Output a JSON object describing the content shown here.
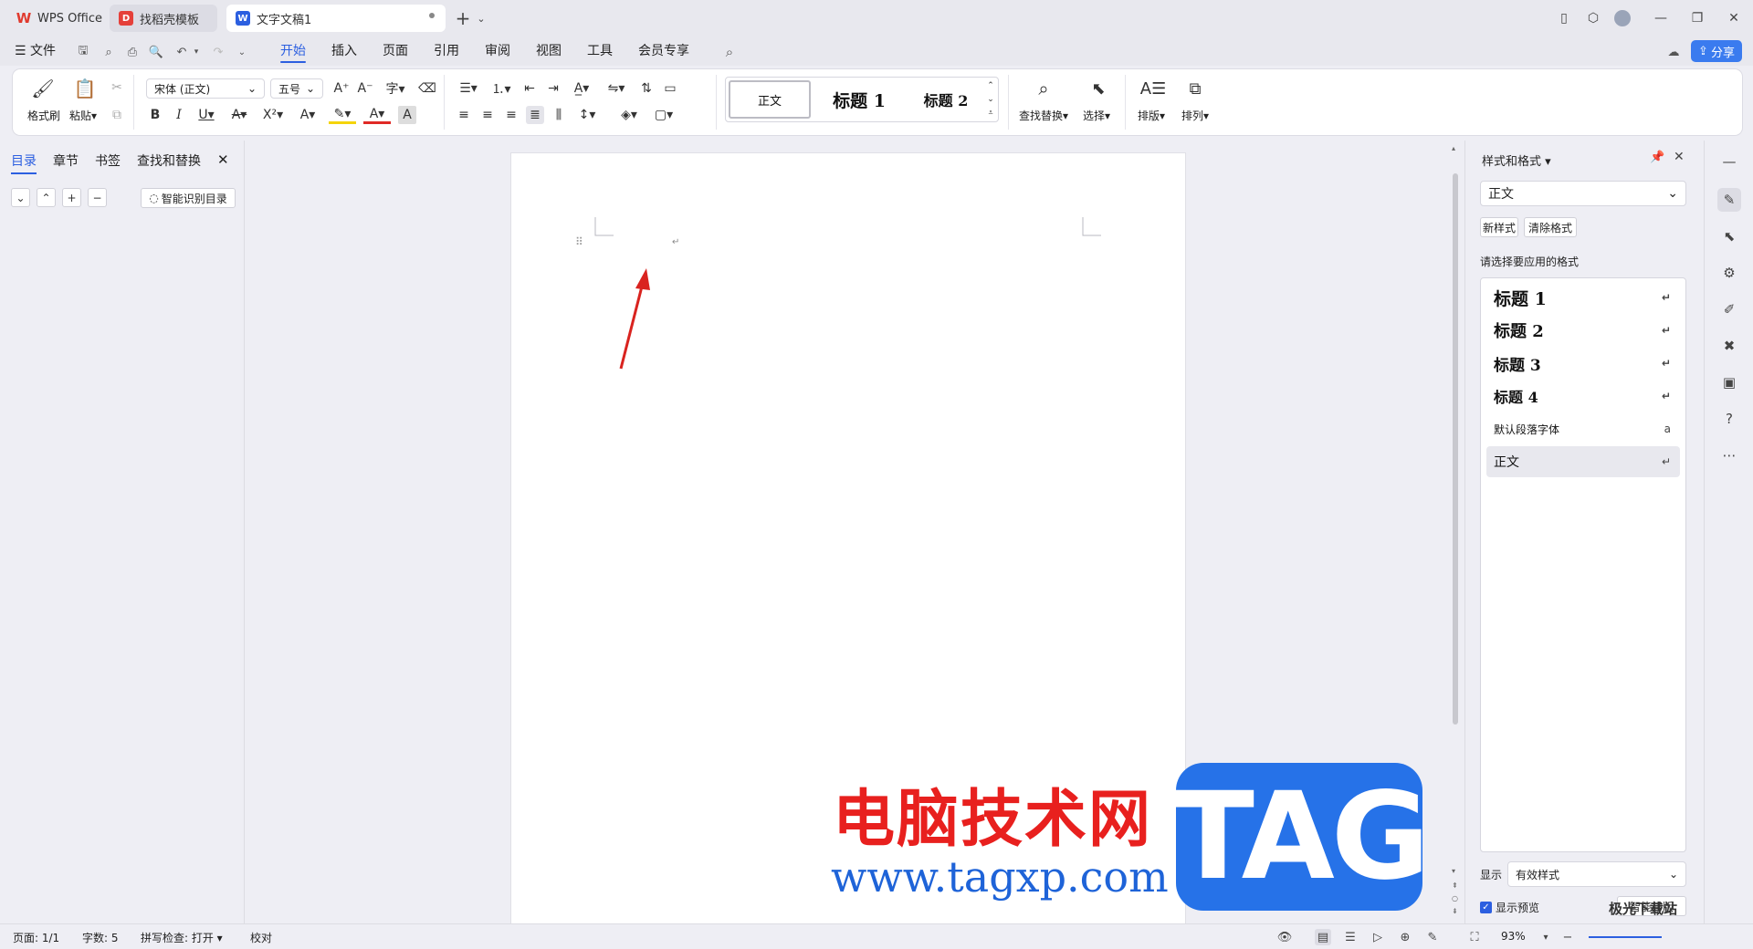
{
  "titlebar": {
    "tabs": [
      {
        "label": "WPS Office"
      },
      {
        "label": "找稻壳模板"
      },
      {
        "label": "文字文稿1"
      }
    ],
    "new_tab": "+",
    "new_tab_menu": "⌄"
  },
  "menubar": {
    "file": "文件",
    "tabs": [
      "开始",
      "插入",
      "页面",
      "引用",
      "审阅",
      "视图",
      "工具",
      "会员专享"
    ],
    "active_tab": "开始",
    "share": "分享"
  },
  "ribbon": {
    "format_painter": "格式刷",
    "paste": "粘贴",
    "font_name": "宋体 (正文)",
    "font_size": "五号",
    "styles": {
      "normal": "正文",
      "heading1": "标题 1",
      "heading2": "标题 2"
    },
    "find_replace": "查找替换",
    "select": "选择",
    "layout": "排版",
    "arrange": "排列"
  },
  "left_panel": {
    "tabs": [
      "目录",
      "章节",
      "书签",
      "查找和替换"
    ],
    "active_tab": "目录",
    "smart_toc": "智能识别目录"
  },
  "right_panel": {
    "title": "样式和格式",
    "current_style": "正文",
    "new_style": "新样式",
    "clear_format": "清除格式",
    "hint": "请选择要应用的格式",
    "style_items": [
      {
        "label": "标题 1",
        "marker": "↵"
      },
      {
        "label": "标题 2",
        "marker": "↵"
      },
      {
        "label": "标题 3",
        "marker": "↵"
      },
      {
        "label": "标题 4",
        "marker": "↵"
      },
      {
        "label": "默认段落字体",
        "marker": "a"
      },
      {
        "label": "正文",
        "marker": "↵"
      }
    ],
    "selected_style": "正文",
    "show_label": "显示",
    "show_value": "有效样式",
    "show_preview": "显示预览",
    "smart_layout": "智能排版"
  },
  "statusbar": {
    "page": "页面: 1/1",
    "words": "字数: 5",
    "spellcheck": "拼写检查: 打开",
    "proofread": "校对",
    "zoom": "93%"
  },
  "watermark": {
    "cn_text": "电脑技术网",
    "url": "www.tagxp.com",
    "tag": "TAG",
    "site": "极光下载站"
  },
  "colors": {
    "accent": "#2c5fe0",
    "share_button": "#3a7bef",
    "annotation_arrow": "#d9231f"
  }
}
